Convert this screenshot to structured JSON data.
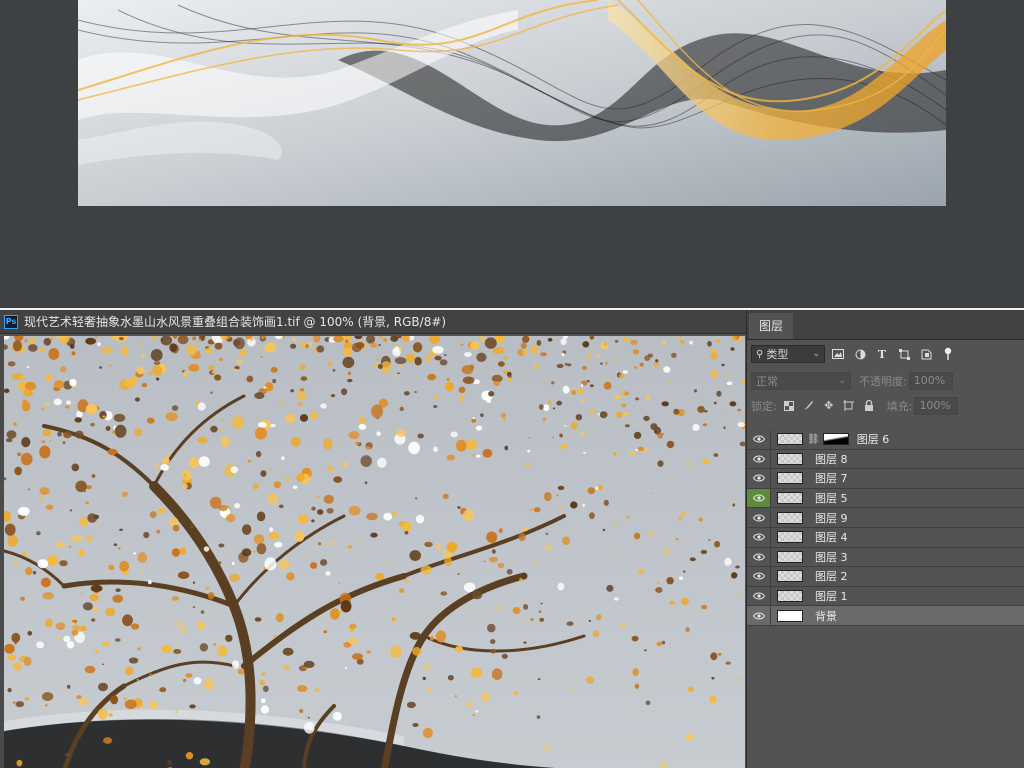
{
  "document": {
    "tab_title": "现代艺术轻奢抽象水墨山水风景重叠组合装饰画1.tif @ 100% (背景, RGB/8#)",
    "app_logo_text": "Ps"
  },
  "layers_panel": {
    "tab_label": "图层",
    "filter": {
      "kind_label": "类型",
      "icons": [
        "image-filter-icon",
        "adjustment-filter-icon",
        "type-filter-icon",
        "shape-filter-icon",
        "smart-object-filter-icon",
        "filter-toggle-icon"
      ]
    },
    "blend_mode": "正常",
    "opacity_label": "不透明度:",
    "opacity_value": "100%",
    "lock_label": "锁定:",
    "lock_icons": [
      "lock-transparent-icon",
      "lock-image-icon",
      "lock-position-icon",
      "lock-artboard-icon",
      "lock-all-icon"
    ],
    "fill_label": "填充:",
    "fill_value": "100%",
    "layers": [
      {
        "name": "图层 6",
        "visible": true,
        "has_mask": true,
        "selected": false,
        "eye_active": false
      },
      {
        "name": "图层 8",
        "visible": true,
        "has_mask": false,
        "selected": false,
        "eye_active": false
      },
      {
        "name": "图层 7",
        "visible": true,
        "has_mask": false,
        "selected": false,
        "eye_active": false
      },
      {
        "name": "图层 5",
        "visible": true,
        "has_mask": false,
        "selected": false,
        "eye_active": true
      },
      {
        "name": "图层 9",
        "visible": true,
        "has_mask": false,
        "selected": false,
        "eye_active": false
      },
      {
        "name": "图层 4",
        "visible": true,
        "has_mask": false,
        "selected": false,
        "eye_active": false
      },
      {
        "name": "图层 3",
        "visible": true,
        "has_mask": false,
        "selected": false,
        "eye_active": false
      },
      {
        "name": "图层 2",
        "visible": true,
        "has_mask": false,
        "selected": false,
        "eye_active": false
      },
      {
        "name": "图层 1",
        "visible": true,
        "has_mask": false,
        "selected": false,
        "eye_active": false
      },
      {
        "name": "背景",
        "visible": true,
        "has_mask": false,
        "selected": true,
        "eye_active": false
      }
    ]
  },
  "colors": {
    "workspace_bg": "#3e4144",
    "panel_bg": "#535353",
    "gold": "#f0a928",
    "eye_active_bg": "#5e8a3c"
  }
}
